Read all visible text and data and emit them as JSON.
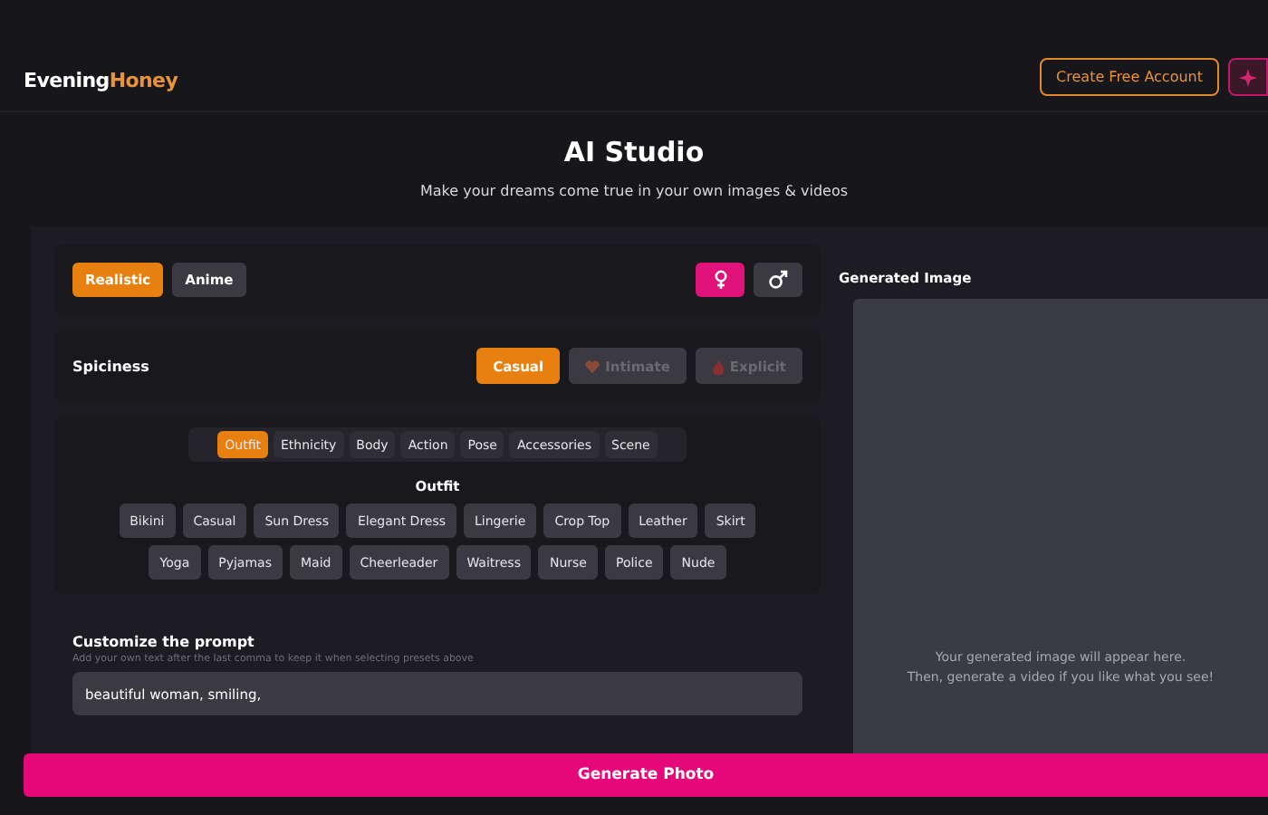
{
  "header": {
    "logo": [
      "Evening",
      "Honey"
    ],
    "create_account": "Create Free Account"
  },
  "hero": {
    "title": "AI Studio",
    "subtitle": "Make your dreams come true in your own images & videos"
  },
  "styles": [
    {
      "label": "Realistic",
      "selected": true
    },
    {
      "label": "Anime",
      "selected": false
    }
  ],
  "genders": [
    {
      "kind": "female",
      "selected": true
    },
    {
      "kind": "male",
      "selected": false
    }
  ],
  "spiciness": {
    "label": "Spiciness",
    "options": [
      {
        "label": "Casual",
        "kind": "plain",
        "selected": true,
        "disabled": false
      },
      {
        "label": "Intimate",
        "kind": "heart",
        "selected": false,
        "disabled": true
      },
      {
        "label": "Explicit",
        "kind": "flame",
        "selected": false,
        "disabled": true
      }
    ]
  },
  "categories": [
    {
      "label": "Outfit",
      "selected": true
    },
    {
      "label": "Ethnicity",
      "selected": false
    },
    {
      "label": "Body",
      "selected": false
    },
    {
      "label": "Action",
      "selected": false
    },
    {
      "label": "Pose",
      "selected": false
    },
    {
      "label": "Accessories",
      "selected": false
    },
    {
      "label": "Scene",
      "selected": false
    }
  ],
  "presets": {
    "title": "Outfit",
    "items": [
      "Bikini",
      "Casual",
      "Sun Dress",
      "Elegant Dress",
      "Lingerie",
      "Crop Top",
      "Leather",
      "Skirt",
      "Yoga",
      "Pyjamas",
      "Maid",
      "Cheerleader",
      "Waitress",
      "Nurse",
      "Police",
      "Nude"
    ]
  },
  "prompt": {
    "title": "Customize the prompt",
    "hint": "Add your own text after the last comma to keep it when selecting presets above",
    "value": "beautiful woman, smiling,"
  },
  "output": {
    "title": "Generated Image",
    "placeholder": [
      "Your generated image will appear here.",
      "Then, generate a video if you like what you see!"
    ]
  },
  "generate": "Generate Photo"
}
